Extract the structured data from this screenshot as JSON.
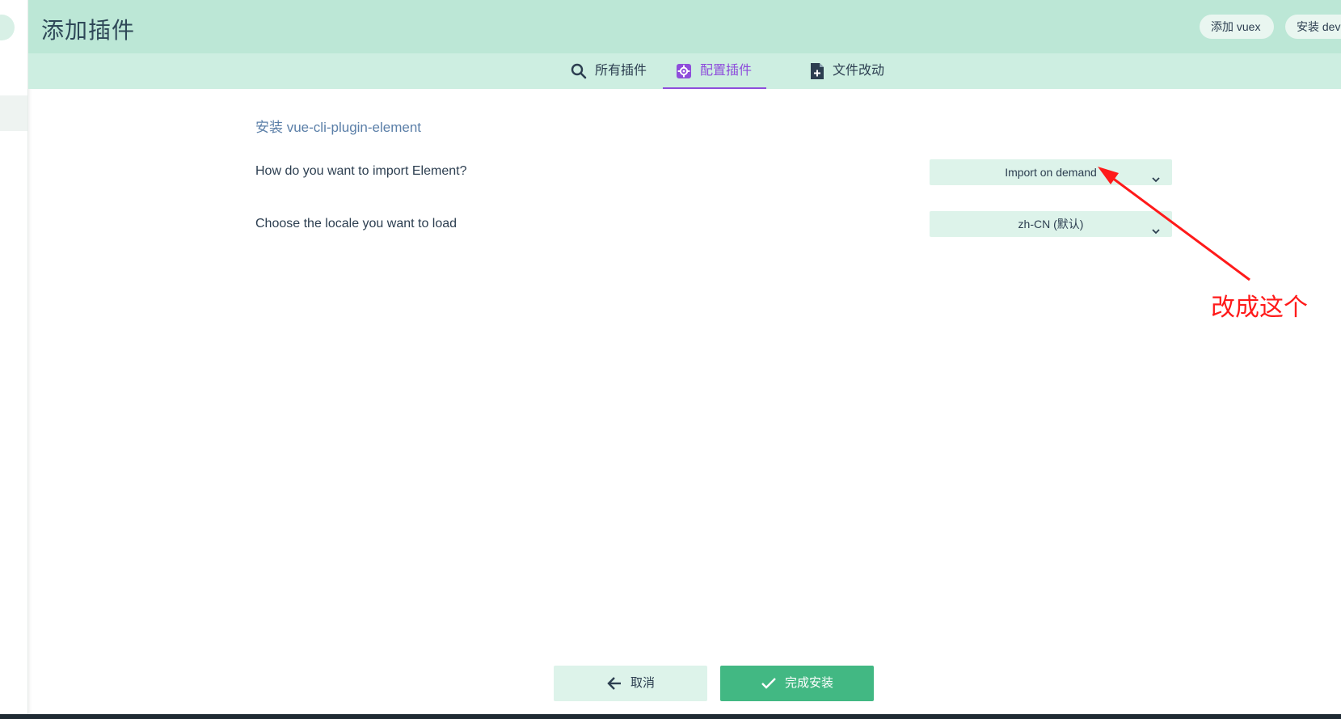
{
  "header": {
    "title": "添加插件",
    "buttons": [
      {
        "label": "添加 vuex"
      },
      {
        "label": "安装 dev"
      }
    ]
  },
  "tabs": [
    {
      "label": "所有插件",
      "icon": "search-icon",
      "active": false
    },
    {
      "label": "配置插件",
      "icon": "gear-icon",
      "active": true
    },
    {
      "label": "文件改动",
      "icon": "file-add-icon",
      "active": false
    }
  ],
  "main": {
    "section_title": "安装 vue-cli-plugin-element",
    "fields": [
      {
        "label": "How do you want to import Element?",
        "value": "Import on demand"
      },
      {
        "label": "Choose the locale you want to load",
        "value": "zh-CN (默认)"
      }
    ]
  },
  "annotation": {
    "text": "改成这个",
    "color": "#ff1a1a"
  },
  "footer": {
    "cancel_label": "取消",
    "finish_label": "完成安装"
  },
  "colors": {
    "header_bg": "#bce7d6",
    "tabs_bg": "#cdeee1",
    "active_tab": "#8e4ddb",
    "primary": "#42b883",
    "select_bg": "#ddf3ea"
  }
}
